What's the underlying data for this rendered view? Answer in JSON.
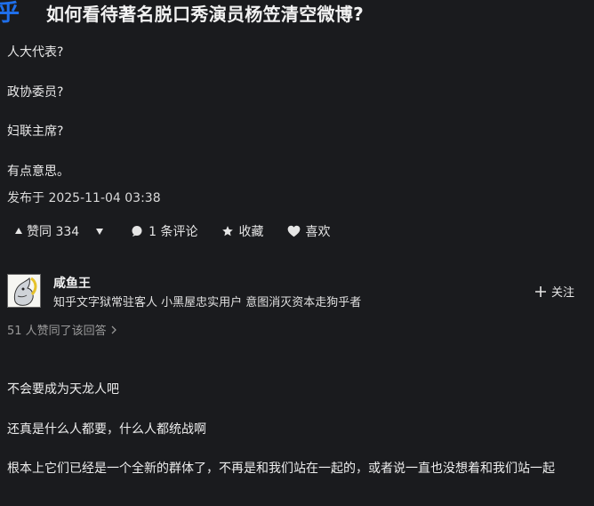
{
  "header": {
    "logo_char": "乎",
    "question_title": "如何看待著名脱口秀演员杨笠清空微博?"
  },
  "answer_top": {
    "paragraphs": [
      "人大代表?",
      "政协委员?",
      "妇联主席?",
      "有点意思。"
    ],
    "publish_time": "发布于 2025-11-04 03:38",
    "actions": {
      "upvote_label": "赞同 334",
      "comment_label": "1 条评论",
      "collect_label": "收藏",
      "like_label": "喜欢"
    }
  },
  "next_answer": {
    "author_name": "咸鱼王",
    "author_bio": "知乎文字狱常驻客人 小黑屋忠实用户 意图消灭资本走狗乎者",
    "follow_label": "关注",
    "agree_summary": "51 人赞同了该回答",
    "paragraphs": [
      "不会要成为天龙人吧",
      "还真是什么人都要，什么人都统战啊",
      "根本上它们已经是一个全新的群体了，不再是和我们站在一起的，或者说一直也没想着和我们站一起"
    ]
  }
}
